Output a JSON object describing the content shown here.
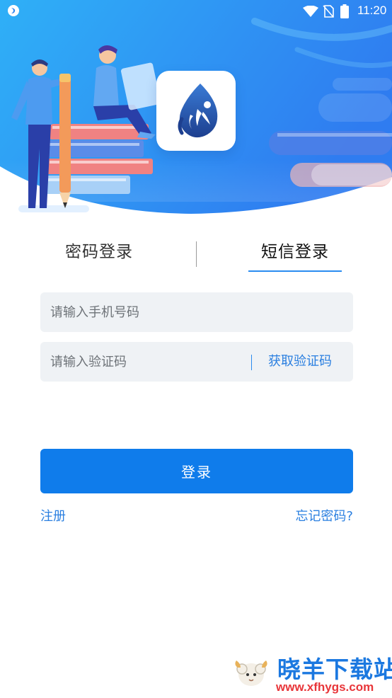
{
  "status_bar": {
    "time": "11:20",
    "icons": [
      "app-notification-icon",
      "wifi-icon",
      "no-sim-icon",
      "battery-icon"
    ]
  },
  "header": {
    "logo": "app-logo-drop-icon",
    "illustration": "people-with-books-and-pencil"
  },
  "tabs": [
    {
      "label": "密码登录",
      "active": false
    },
    {
      "label": "短信登录",
      "active": true
    }
  ],
  "form": {
    "phone_placeholder": "请输入手机号码",
    "phone_value": "",
    "code_placeholder": "请输入验证码",
    "code_value": "",
    "get_code_label": "获取验证码"
  },
  "actions": {
    "login_label": "登录",
    "register_label": "注册",
    "forgot_label": "忘记密码?"
  },
  "watermark": {
    "title": "晓羊下载站",
    "url": "www.xfhygs.com"
  },
  "colors": {
    "primary": "#0f7ceb",
    "link": "#2a7fe0",
    "header_gradient_start": "#2fb0f7",
    "header_gradient_end": "#2f7cf0",
    "input_background": "#eff2f5"
  }
}
